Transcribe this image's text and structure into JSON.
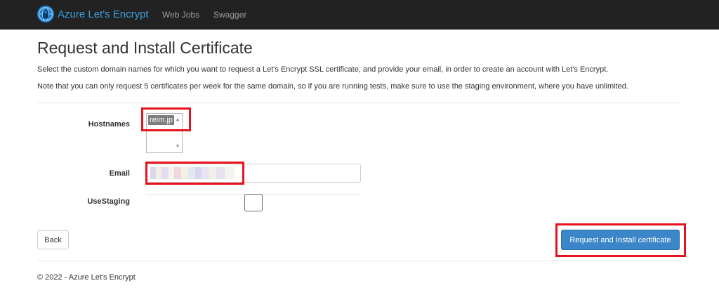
{
  "navbar": {
    "brand": "Azure Let's Encrypt",
    "links": [
      "Web Jobs",
      "Swagger"
    ]
  },
  "page": {
    "title": "Request and Install Certificate",
    "description1": "Select the custom domain names for which you want to request a Let's Encrypt SSL certificate, and provide your email, in order to create an account with Let's Encrypt.",
    "description2": "Note that you can only request 5 certificates per week for the same domain, so if you are running tests, make sure to use the staging environment, where you have unlimited."
  },
  "form": {
    "hostnames_label": "Hostnames",
    "hostnames_options": [
      "reim.jp"
    ],
    "email_label": "Email",
    "email_value": "",
    "usestaging_label": "UseStaging"
  },
  "buttons": {
    "back": "Back",
    "submit": "Request and Install certificate"
  },
  "footer": {
    "text": "© 2022 - Azure Let's Encrypt"
  },
  "colors": {
    "navbar_bg": "#222222",
    "brand": "#3b9ce0",
    "primary": "#3a86c8",
    "annotation": "#e8121d"
  }
}
